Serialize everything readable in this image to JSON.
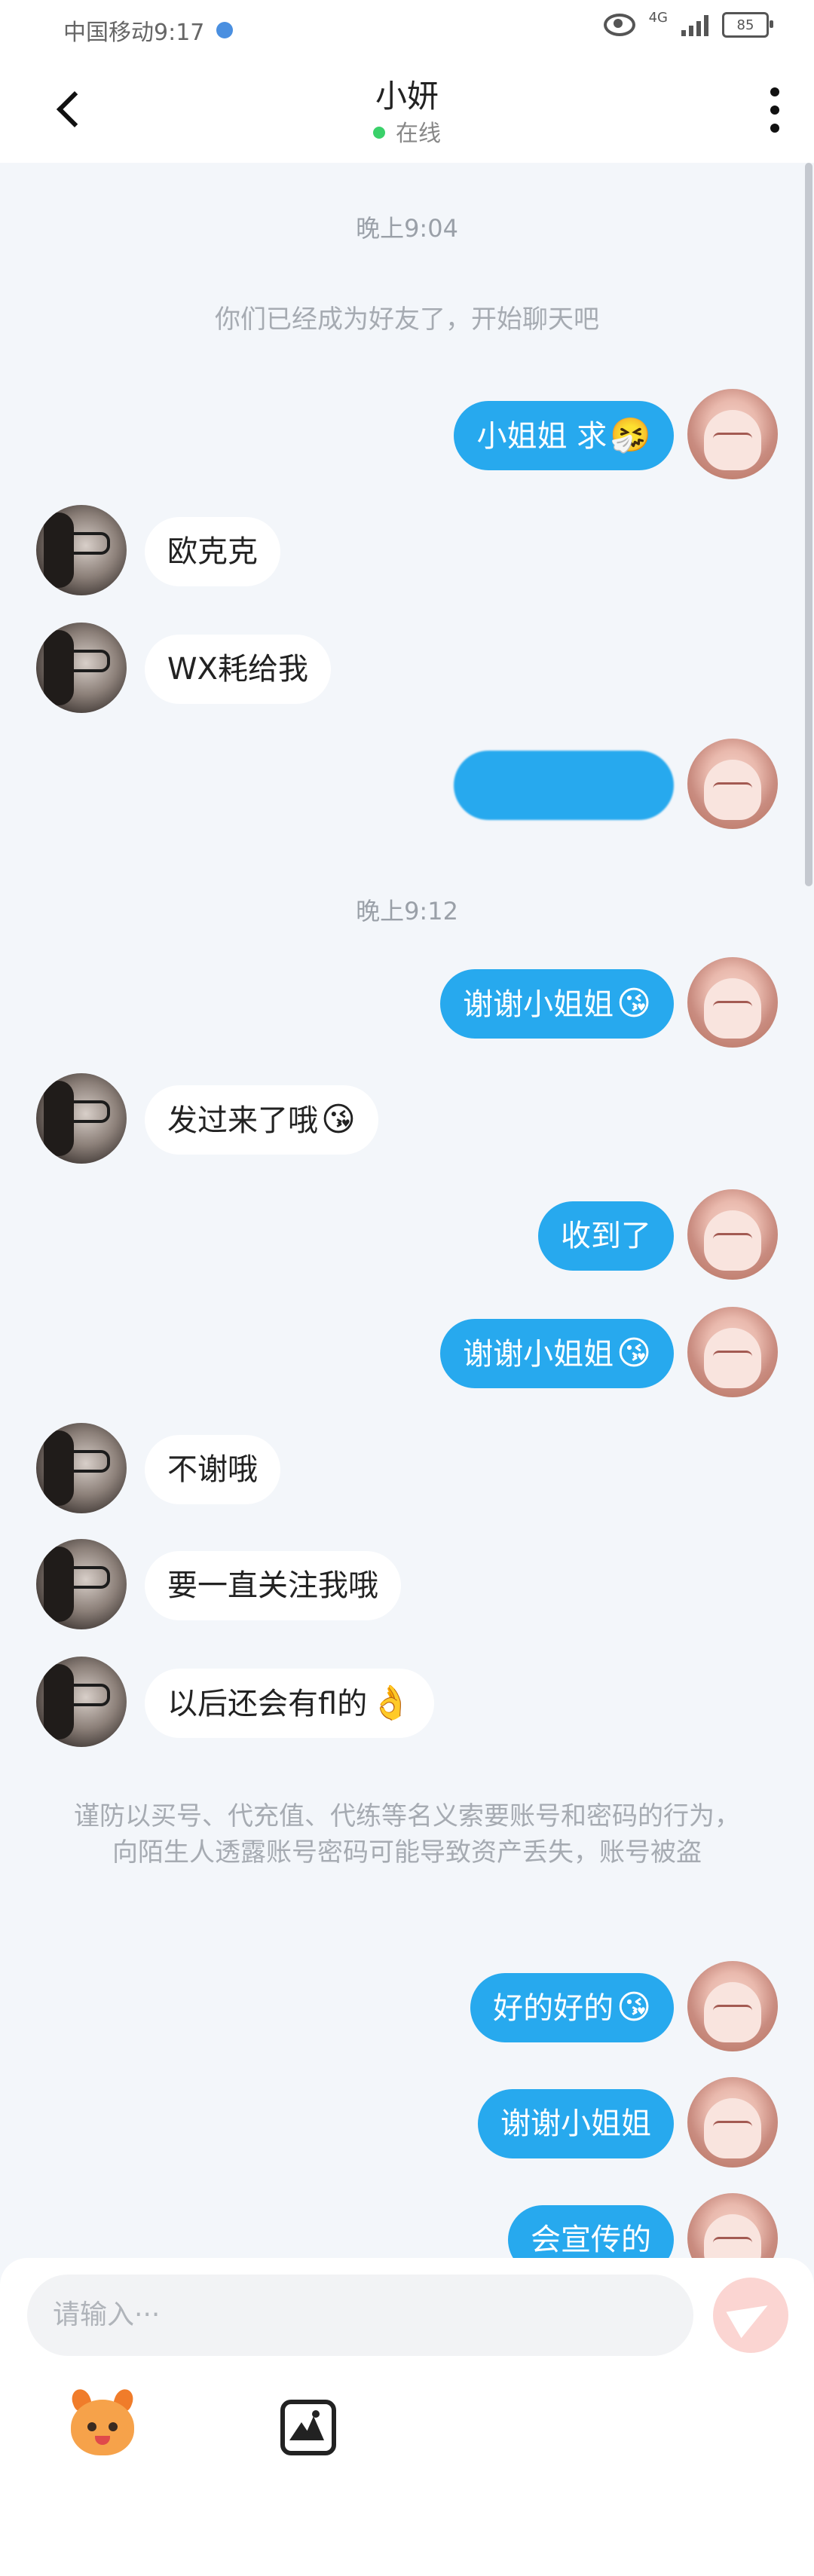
{
  "statusbar": {
    "carrier_time": "中国移动9:17",
    "network": "4G",
    "battery": "85"
  },
  "header": {
    "title": "小妍",
    "status": "在线"
  },
  "chat": {
    "timestamp1": "晚上9:04",
    "friend_note": "你们已经成为好友了，开始聊天吧",
    "timestamp2": "晚上9:12",
    "messages": [
      {
        "from": "me",
        "text": "小姐姐 求",
        "emoji": "🤧"
      },
      {
        "from": "other",
        "text": "欧克克",
        "emoji": ""
      },
      {
        "from": "other",
        "text": "WX耗给我",
        "emoji": ""
      },
      {
        "from": "me",
        "text": "",
        "emoji": "",
        "blurred": true
      },
      {
        "from": "me",
        "text": "谢谢小姐姐",
        "emoji": "😘"
      },
      {
        "from": "other",
        "text": "发过来了哦",
        "emoji": "😘"
      },
      {
        "from": "me",
        "text": "收到了",
        "emoji": ""
      },
      {
        "from": "me",
        "text": "谢谢小姐姐",
        "emoji": "😘"
      },
      {
        "from": "other",
        "text": "不谢哦",
        "emoji": ""
      },
      {
        "from": "other",
        "text": "要一直关注我哦",
        "emoji": ""
      },
      {
        "from": "other",
        "text": "以后还会有fl的",
        "emoji": "👌"
      },
      {
        "from": "me",
        "text": "好的好的",
        "emoji": "😘"
      },
      {
        "from": "me",
        "text": "谢谢小姐姐",
        "emoji": ""
      },
      {
        "from": "me",
        "text": "会宣传的",
        "emoji": ""
      }
    ],
    "warning": "谨防以买号、代充值、代练等名义索要账号和密码的行为，向陌生人透露账号密码可能导致资产丢失，账号被盗"
  },
  "composer": {
    "placeholder": "请输入···"
  },
  "icons": {
    "back": "back-arrow-icon",
    "more": "more-vertical-icon",
    "send": "send-icon",
    "emoji_tool": "emoji-sticker-icon",
    "image_tool": "image-icon"
  },
  "colors": {
    "my_bubble": "#27a9ee",
    "other_bubble": "#ffffff",
    "background": "#f3f6fa",
    "online": "#3ad16a",
    "send_button": "#fbd5d2"
  }
}
